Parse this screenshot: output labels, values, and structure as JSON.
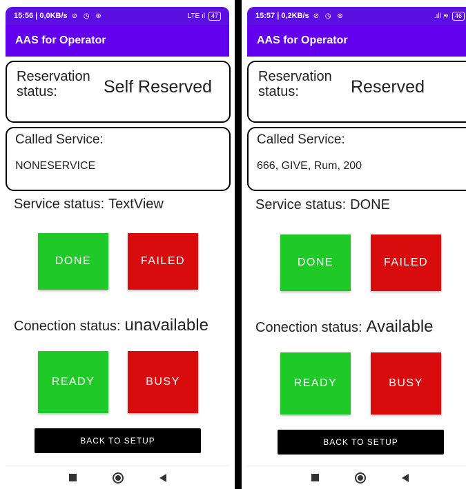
{
  "colors": {
    "app_bar": "#6200ee",
    "status_bar": "#5b0fe0",
    "done_green": "#1ec928",
    "failed_red": "#d80c0c",
    "back_button": "#000000"
  },
  "screens": [
    {
      "status_bar": {
        "time": "15:56 | 0,0KB/s",
        "system_icons": "⊘ ◷ ⊛",
        "network": "LTE ıl",
        "battery": "47"
      },
      "app_title": "AAS for Operator",
      "reservation": {
        "label": "Reservation status:",
        "value": "Self Reserved"
      },
      "called_service": {
        "label": "Called Service:",
        "value": "NONESERVICE"
      },
      "service_status": {
        "label": "Service status:",
        "value": "TextView"
      },
      "service_buttons": {
        "done": "DONE",
        "failed": "FAILED"
      },
      "connection_status": {
        "label": "Conection status:",
        "value": "unavailable"
      },
      "connection_buttons": {
        "ready": "READY",
        "busy": "BUSY"
      },
      "back_button": "BACK TO SETUP"
    },
    {
      "status_bar": {
        "time": "15:57 | 0,2KB/s",
        "system_icons": "⊘ ◷ ⊛",
        "network": ".ıll ≋",
        "battery": "46"
      },
      "app_title": "AAS for Operator",
      "reservation": {
        "label": "Reservation status:",
        "value": "Reserved"
      },
      "called_service": {
        "label": "Called Service:",
        "value": "666, GIVE, Rum, 200"
      },
      "service_status": {
        "label": "Service status:",
        "value": "DONE"
      },
      "service_buttons": {
        "done": "DONE",
        "failed": "FAILED"
      },
      "connection_status": {
        "label": "Conection status:",
        "value": "Available"
      },
      "connection_buttons": {
        "ready": "READY",
        "busy": "BUSY"
      },
      "back_button": "BACK TO SETUP"
    }
  ]
}
